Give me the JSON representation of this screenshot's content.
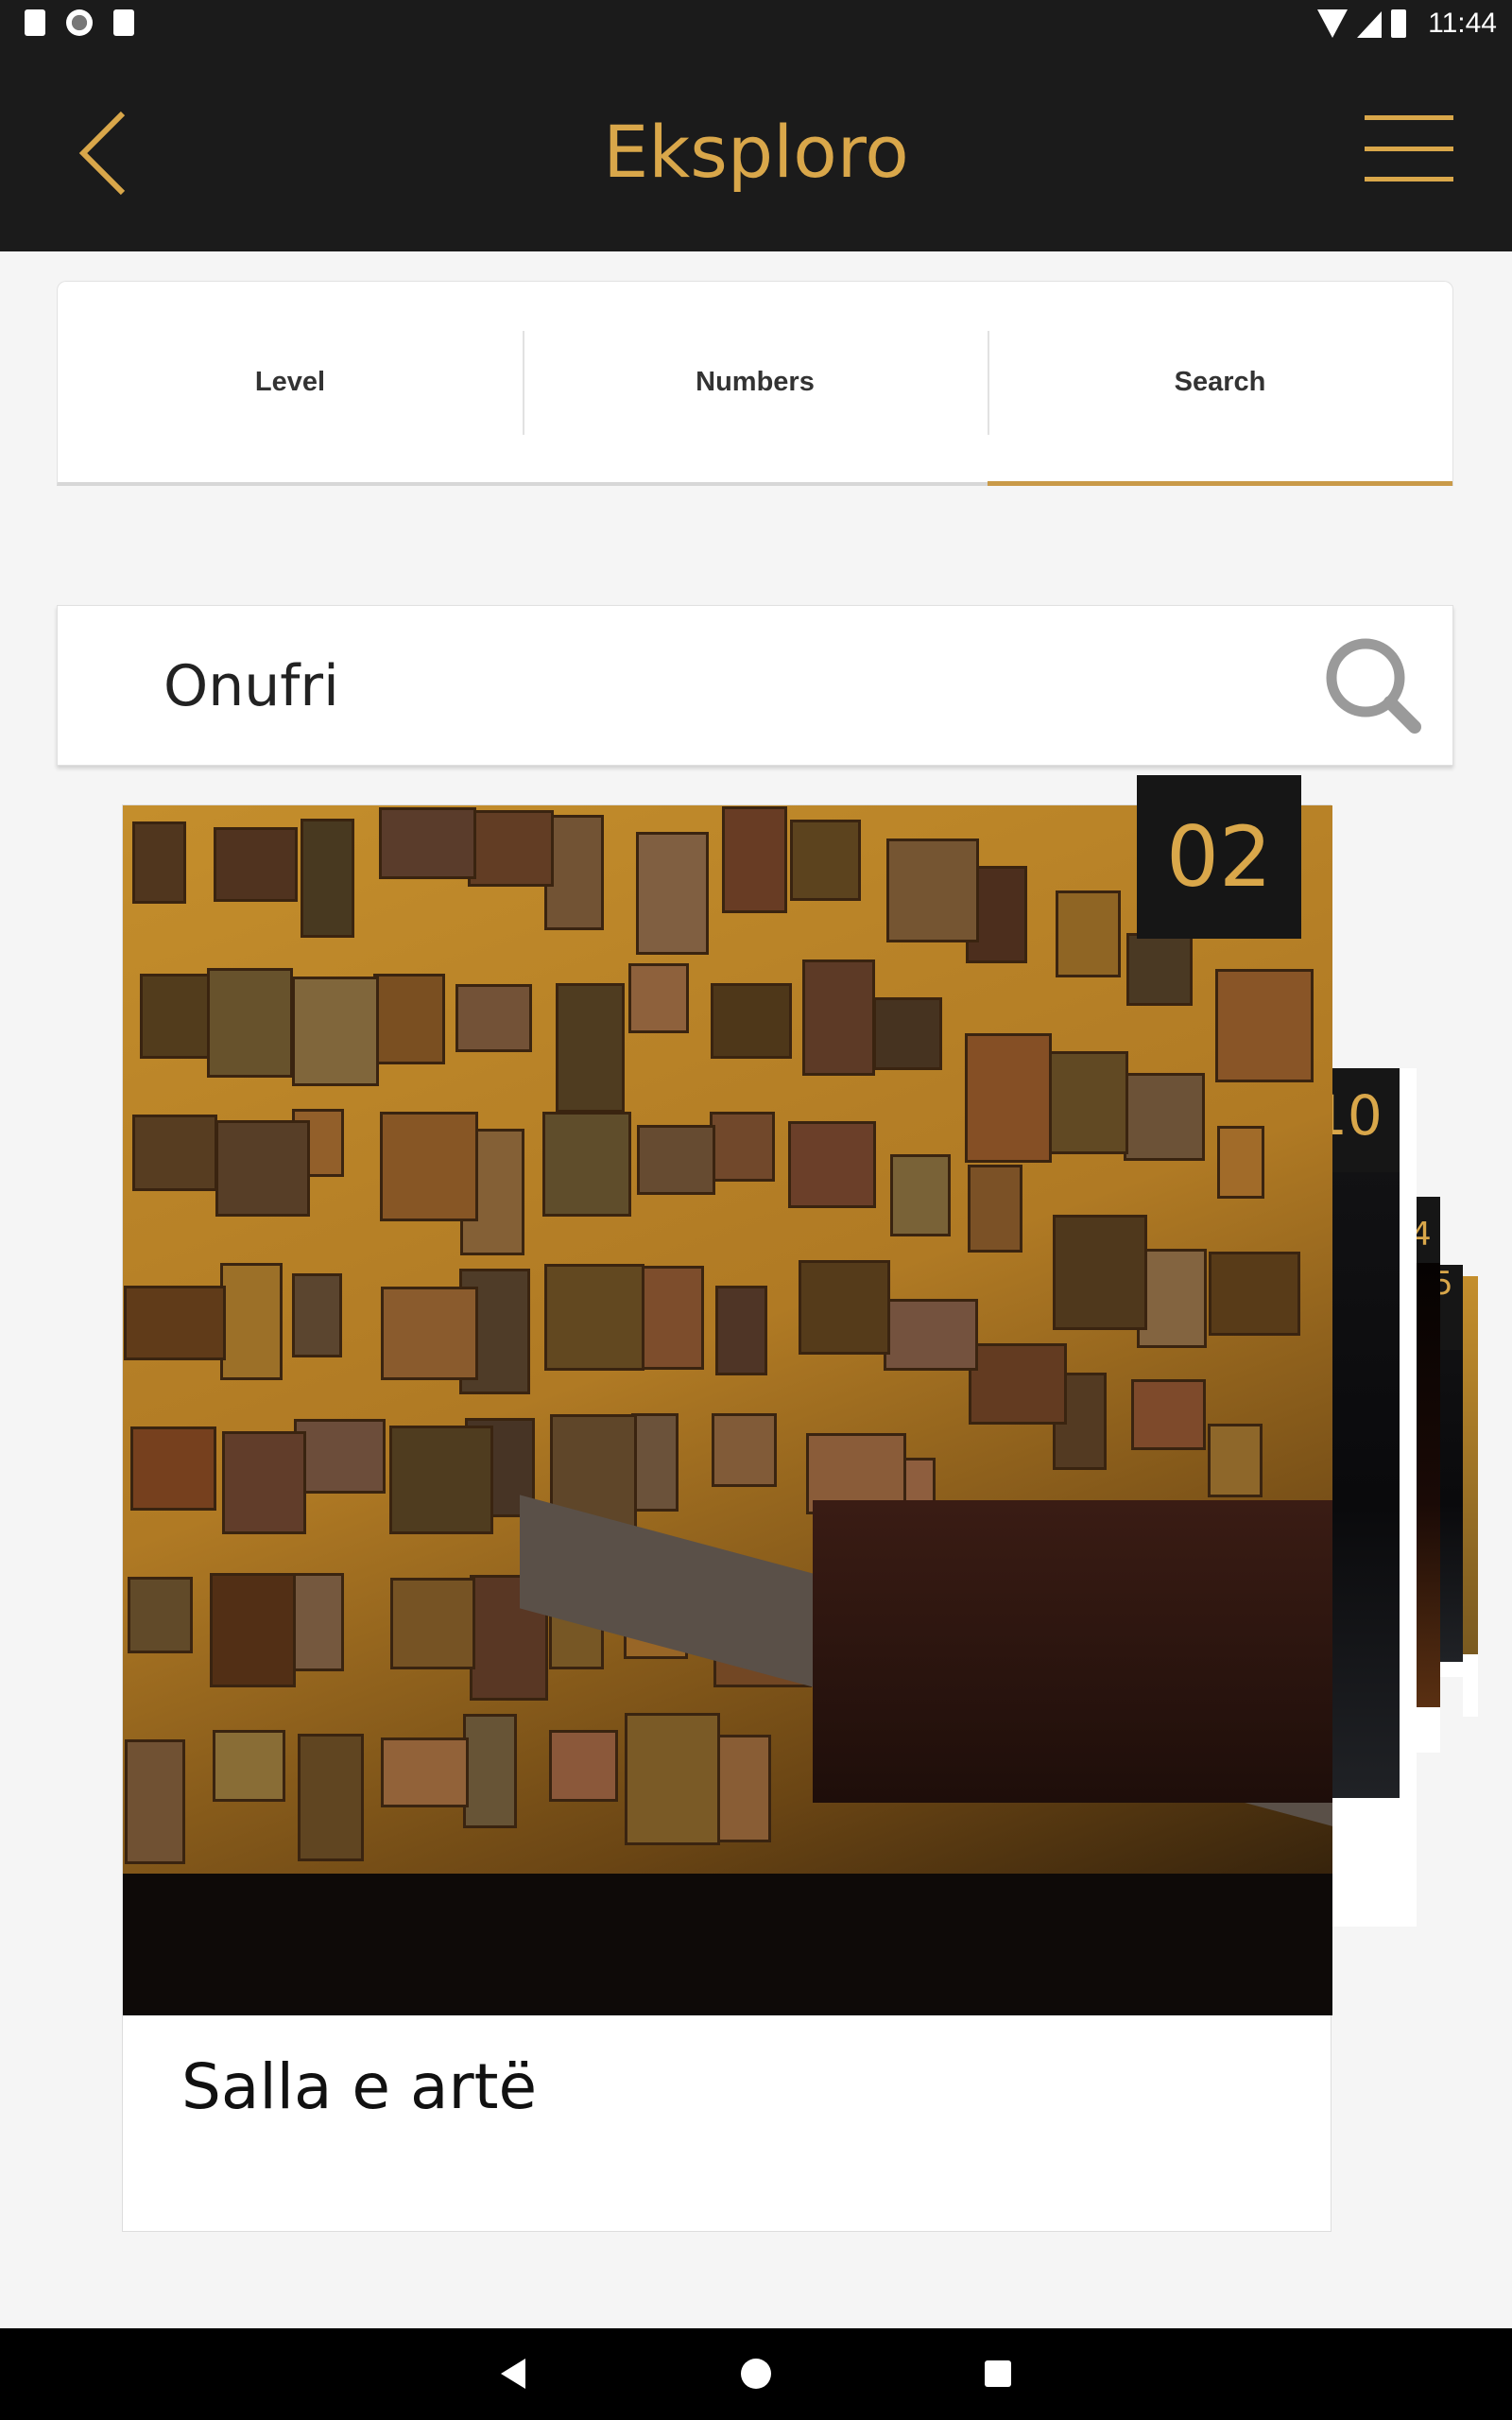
{
  "status_bar": {
    "time": "11:44",
    "icons": [
      "a-badge-icon",
      "record-icon",
      "sd-card-icon",
      "wifi-icon",
      "signal-icon",
      "battery-icon"
    ]
  },
  "header": {
    "title": "Eksploro",
    "back_icon": "chevron-left-icon",
    "menu_icon": "hamburger-menu-icon"
  },
  "tabs": [
    {
      "label": "Level",
      "active": false
    },
    {
      "label": "Numbers",
      "active": false
    },
    {
      "label": "Search",
      "active": true
    }
  ],
  "search": {
    "value": "Onufri",
    "icon": "search-icon"
  },
  "cards": {
    "main": {
      "number": "02",
      "title": "Salla e artë"
    },
    "stacked": [
      {
        "number": "10"
      },
      {
        "number": "4"
      },
      {
        "number": "5"
      }
    ]
  },
  "colors": {
    "accent": "#d9a74a",
    "header_bg": "#1b1b1b"
  },
  "nav_bar": {
    "icons": [
      "back-triangle-icon",
      "home-circle-icon",
      "recents-square-icon"
    ]
  }
}
